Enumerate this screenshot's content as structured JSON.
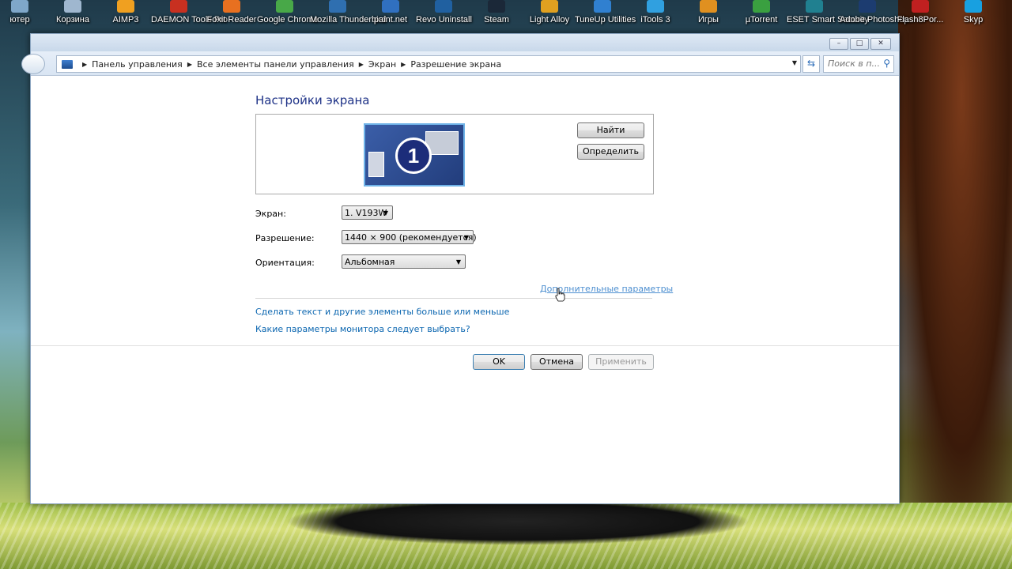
{
  "desktop": {
    "icons": [
      {
        "label": "ютер",
        "color": "#7fa7c9"
      },
      {
        "label": "Корзина",
        "color": "#9fb7cf"
      },
      {
        "label": "AIMP3",
        "color": "#f0a020"
      },
      {
        "label": "DAEMON Tools Pro",
        "color": "#c83020"
      },
      {
        "label": "Foxit Reader",
        "color": "#e87020"
      },
      {
        "label": "Google Chrome",
        "color": "#48a848"
      },
      {
        "label": "Mozilla Thunderbird",
        "color": "#2f6fb0"
      },
      {
        "label": "paint.net",
        "color": "#3070c0"
      },
      {
        "label": "Revo Uninstall",
        "color": "#2060a0"
      },
      {
        "label": "Steam",
        "color": "#1b2838"
      },
      {
        "label": "Light Alloy",
        "color": "#e0a020"
      },
      {
        "label": "TuneUp Utilities",
        "color": "#3080d0"
      },
      {
        "label": "iTools 3",
        "color": "#30a0e0"
      },
      {
        "label": "Игры",
        "color": "#e09020"
      },
      {
        "label": "µTorrent",
        "color": "#3aa040"
      },
      {
        "label": "ESET Smart Security",
        "color": "#208090"
      },
      {
        "label": "Adobe Photoshop",
        "color": "#1c3c70"
      },
      {
        "label": "Flash8Por...",
        "color": "#c02020"
      },
      {
        "label": "Skyp",
        "color": "#18a0e0"
      }
    ]
  },
  "window": {
    "breadcrumbs": [
      "Панель управления",
      "Все элементы панели управления",
      "Экран",
      "Разрешение экрана"
    ],
    "search_placeholder": "Поиск в п...",
    "title_buttons": {
      "minimize": "–",
      "maximize": "□",
      "close": "✕"
    }
  },
  "settings": {
    "heading": "Настройки экрана",
    "monitor_number": "1",
    "find_button": "Найти",
    "identify_button": "Определить",
    "screen_label": "Экран:",
    "screen_value": "1. V193W",
    "resolution_label": "Разрешение:",
    "resolution_value": "1440 × 900 (рекомендуется)",
    "orientation_label": "Ориентация:",
    "orientation_value": "Альбомная",
    "advanced_link": "Дополнительные параметры",
    "link_text_size": "Сделать текст и другие элементы больше или меньше",
    "link_monitor_help": "Какие параметры монитора следует выбрать?"
  },
  "footer": {
    "ok": "OK",
    "cancel": "Отмена",
    "apply": "Применить"
  }
}
